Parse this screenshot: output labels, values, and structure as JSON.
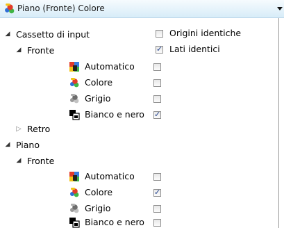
{
  "header": {
    "title": "Piano (Fronte) Colore",
    "icon": "color-mode-icon"
  },
  "tree": {
    "input_tray": {
      "label": "Cassetto di input",
      "option_label": "Origini identiche",
      "option_checked": false,
      "front": {
        "label": "Fronte",
        "option_label": "Lati identici",
        "option_checked": true,
        "modes": [
          {
            "label": "Automatico",
            "icon": "automatic-mode-icon",
            "checked": false
          },
          {
            "label": "Colore",
            "icon": "color-mode-icon",
            "checked": false
          },
          {
            "label": "Grigio",
            "icon": "gray-mode-icon",
            "checked": false
          },
          {
            "label": "Bianco e nero",
            "icon": "black-white-mode-icon",
            "checked": true
          }
        ]
      },
      "back": {
        "label": "Retro"
      }
    },
    "flatbed": {
      "label": "Piano",
      "front": {
        "label": "Fronte",
        "modes": [
          {
            "label": "Automatico",
            "icon": "automatic-mode-icon",
            "checked": false
          },
          {
            "label": "Colore",
            "icon": "color-mode-icon",
            "checked": true
          },
          {
            "label": "Grigio",
            "icon": "gray-mode-icon",
            "checked": false
          },
          {
            "label": "Bianco e nero",
            "icon": "black-white-mode-icon",
            "checked": false
          }
        ]
      }
    }
  }
}
